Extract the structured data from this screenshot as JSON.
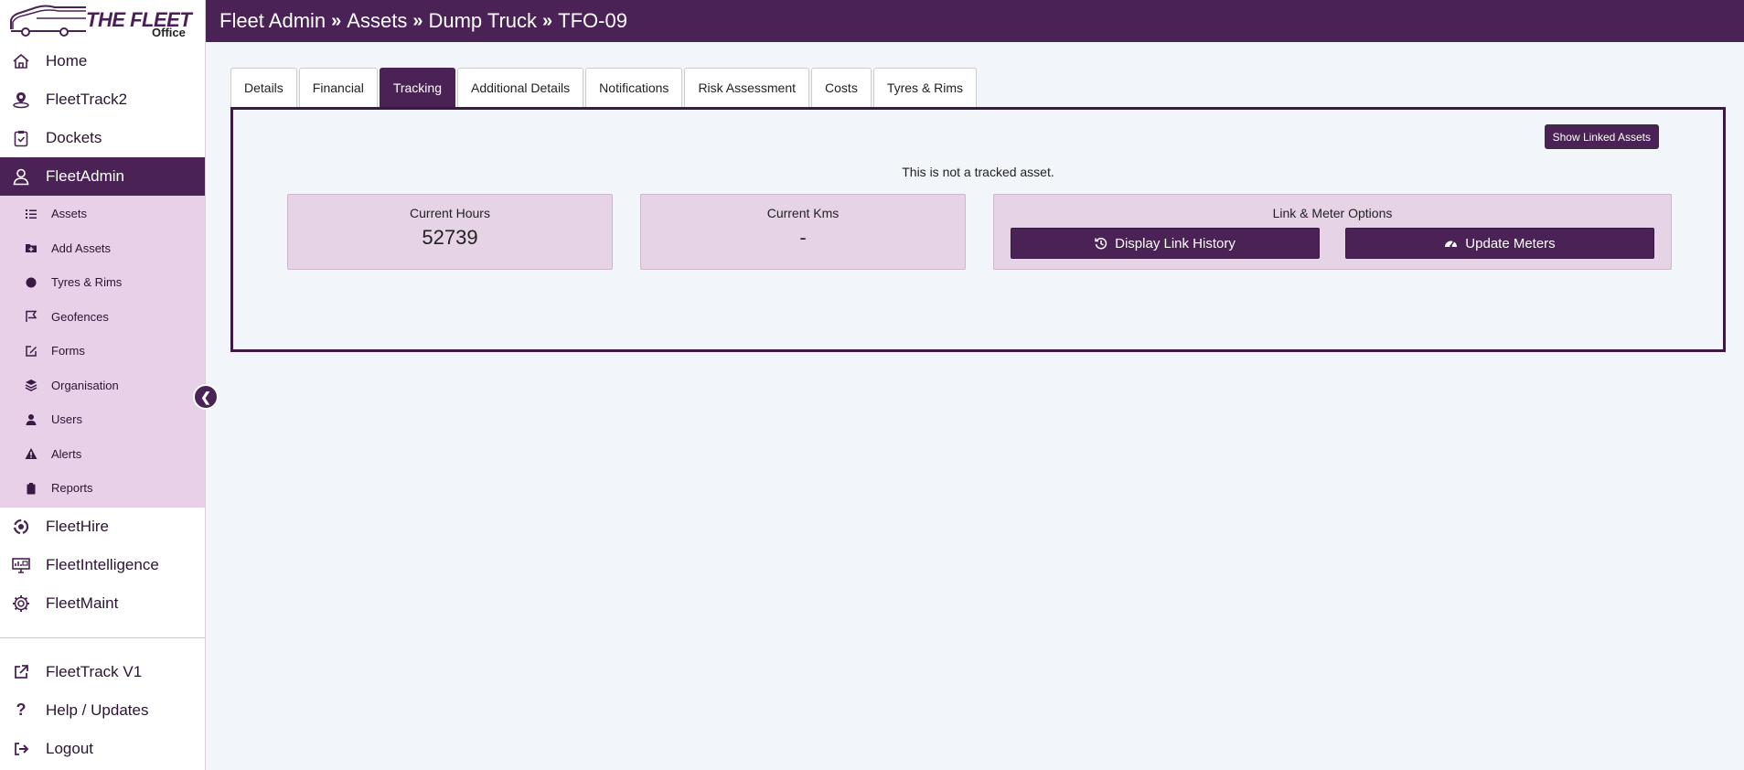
{
  "logo": {
    "title": "THE FLEET",
    "subtitle": "Office"
  },
  "sidebar": {
    "items": [
      {
        "label": "Home",
        "icon": "home-icon"
      },
      {
        "label": "FleetTrack2",
        "icon": "map-pin-icon"
      },
      {
        "label": "Dockets",
        "icon": "clipboard-check-icon"
      },
      {
        "label": "FleetAdmin",
        "icon": "user-icon",
        "active": true
      }
    ],
    "submenu": [
      {
        "label": "Assets",
        "icon": "list-icon"
      },
      {
        "label": "Add Assets",
        "icon": "folder-plus-icon"
      },
      {
        "label": "Tyres & Rims",
        "icon": "circle-icon"
      },
      {
        "label": "Geofences",
        "icon": "flag-icon"
      },
      {
        "label": "Forms",
        "icon": "edit-icon"
      },
      {
        "label": "Organisation",
        "icon": "layers-icon"
      },
      {
        "label": "Users",
        "icon": "user-icon"
      },
      {
        "label": "Alerts",
        "icon": "warning-icon"
      },
      {
        "label": "Reports",
        "icon": "clipboard-icon"
      }
    ],
    "items_after": [
      {
        "label": "FleetHire",
        "icon": "recycle-icon"
      },
      {
        "label": "FleetIntelligence",
        "icon": "monitor-chart-icon"
      },
      {
        "label": "FleetMaint",
        "icon": "gear-icon"
      }
    ],
    "bottom": [
      {
        "label": "FleetTrack V1",
        "icon": "external-link-icon"
      },
      {
        "label": "Help / Updates",
        "icon": "question-icon"
      },
      {
        "label": "Logout",
        "icon": "logout-icon"
      }
    ]
  },
  "header": {
    "breadcrumb": [
      "Fleet Admin",
      "Assets",
      "Dump Truck",
      "TFO-09"
    ],
    "separator": "»"
  },
  "tabs": [
    {
      "label": "Details"
    },
    {
      "label": "Financial"
    },
    {
      "label": "Tracking",
      "active": true
    },
    {
      "label": "Additional Details"
    },
    {
      "label": "Notifications"
    },
    {
      "label": "Risk Assessment"
    },
    {
      "label": "Costs"
    },
    {
      "label": "Tyres & Rims"
    }
  ],
  "tracking": {
    "show_linked_label": "Show Linked Assets",
    "status_message": "This is not a tracked asset.",
    "hours_title": "Current Hours",
    "hours_value": "52739",
    "kms_title": "Current Kms",
    "kms_value": "-",
    "options_title": "Link & Meter Options",
    "link_history_label": "Display Link History",
    "update_meters_label": "Update Meters"
  },
  "colors": {
    "brand": "#4a2255",
    "submenu_bg": "#e8d0e8",
    "card_bg": "#e6d4e6",
    "page_bg": "#f2f5f9"
  }
}
